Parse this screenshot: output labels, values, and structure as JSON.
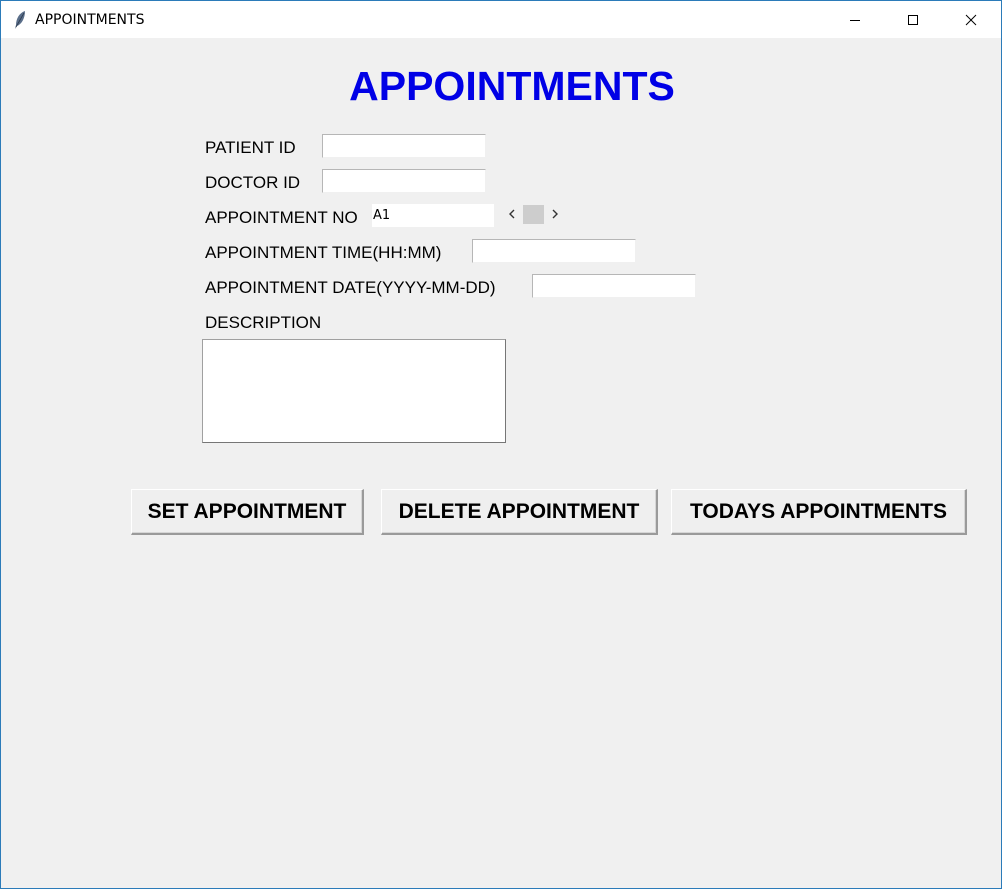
{
  "window": {
    "title": "APPOINTMENTS",
    "controls": [
      "minimize-icon",
      "maximize-icon",
      "close-icon"
    ]
  },
  "heading": "APPOINTMENTS",
  "form": {
    "patient_id": {
      "label": "PATIENT ID",
      "value": ""
    },
    "doctor_id": {
      "label": "DOCTOR ID",
      "value": ""
    },
    "appointment_no": {
      "label": "APPOINTMENT NO",
      "value": "A1"
    },
    "appointment_time": {
      "label": "APPOINTMENT TIME(HH:MM)",
      "value": ""
    },
    "appointment_date": {
      "label": "APPOINTMENT DATE(YYYY-MM-DD)",
      "value": ""
    },
    "description": {
      "label": "DESCRIPTION",
      "value": ""
    }
  },
  "buttons": {
    "set": "SET APPOINTMENT",
    "delete": "DELETE APPOINTMENT",
    "todays": "TODAYS APPOINTMENTS"
  },
  "colors": {
    "heading": "#0000e6",
    "window_border": "#2b7bb9",
    "background": "#f0f0f0"
  }
}
